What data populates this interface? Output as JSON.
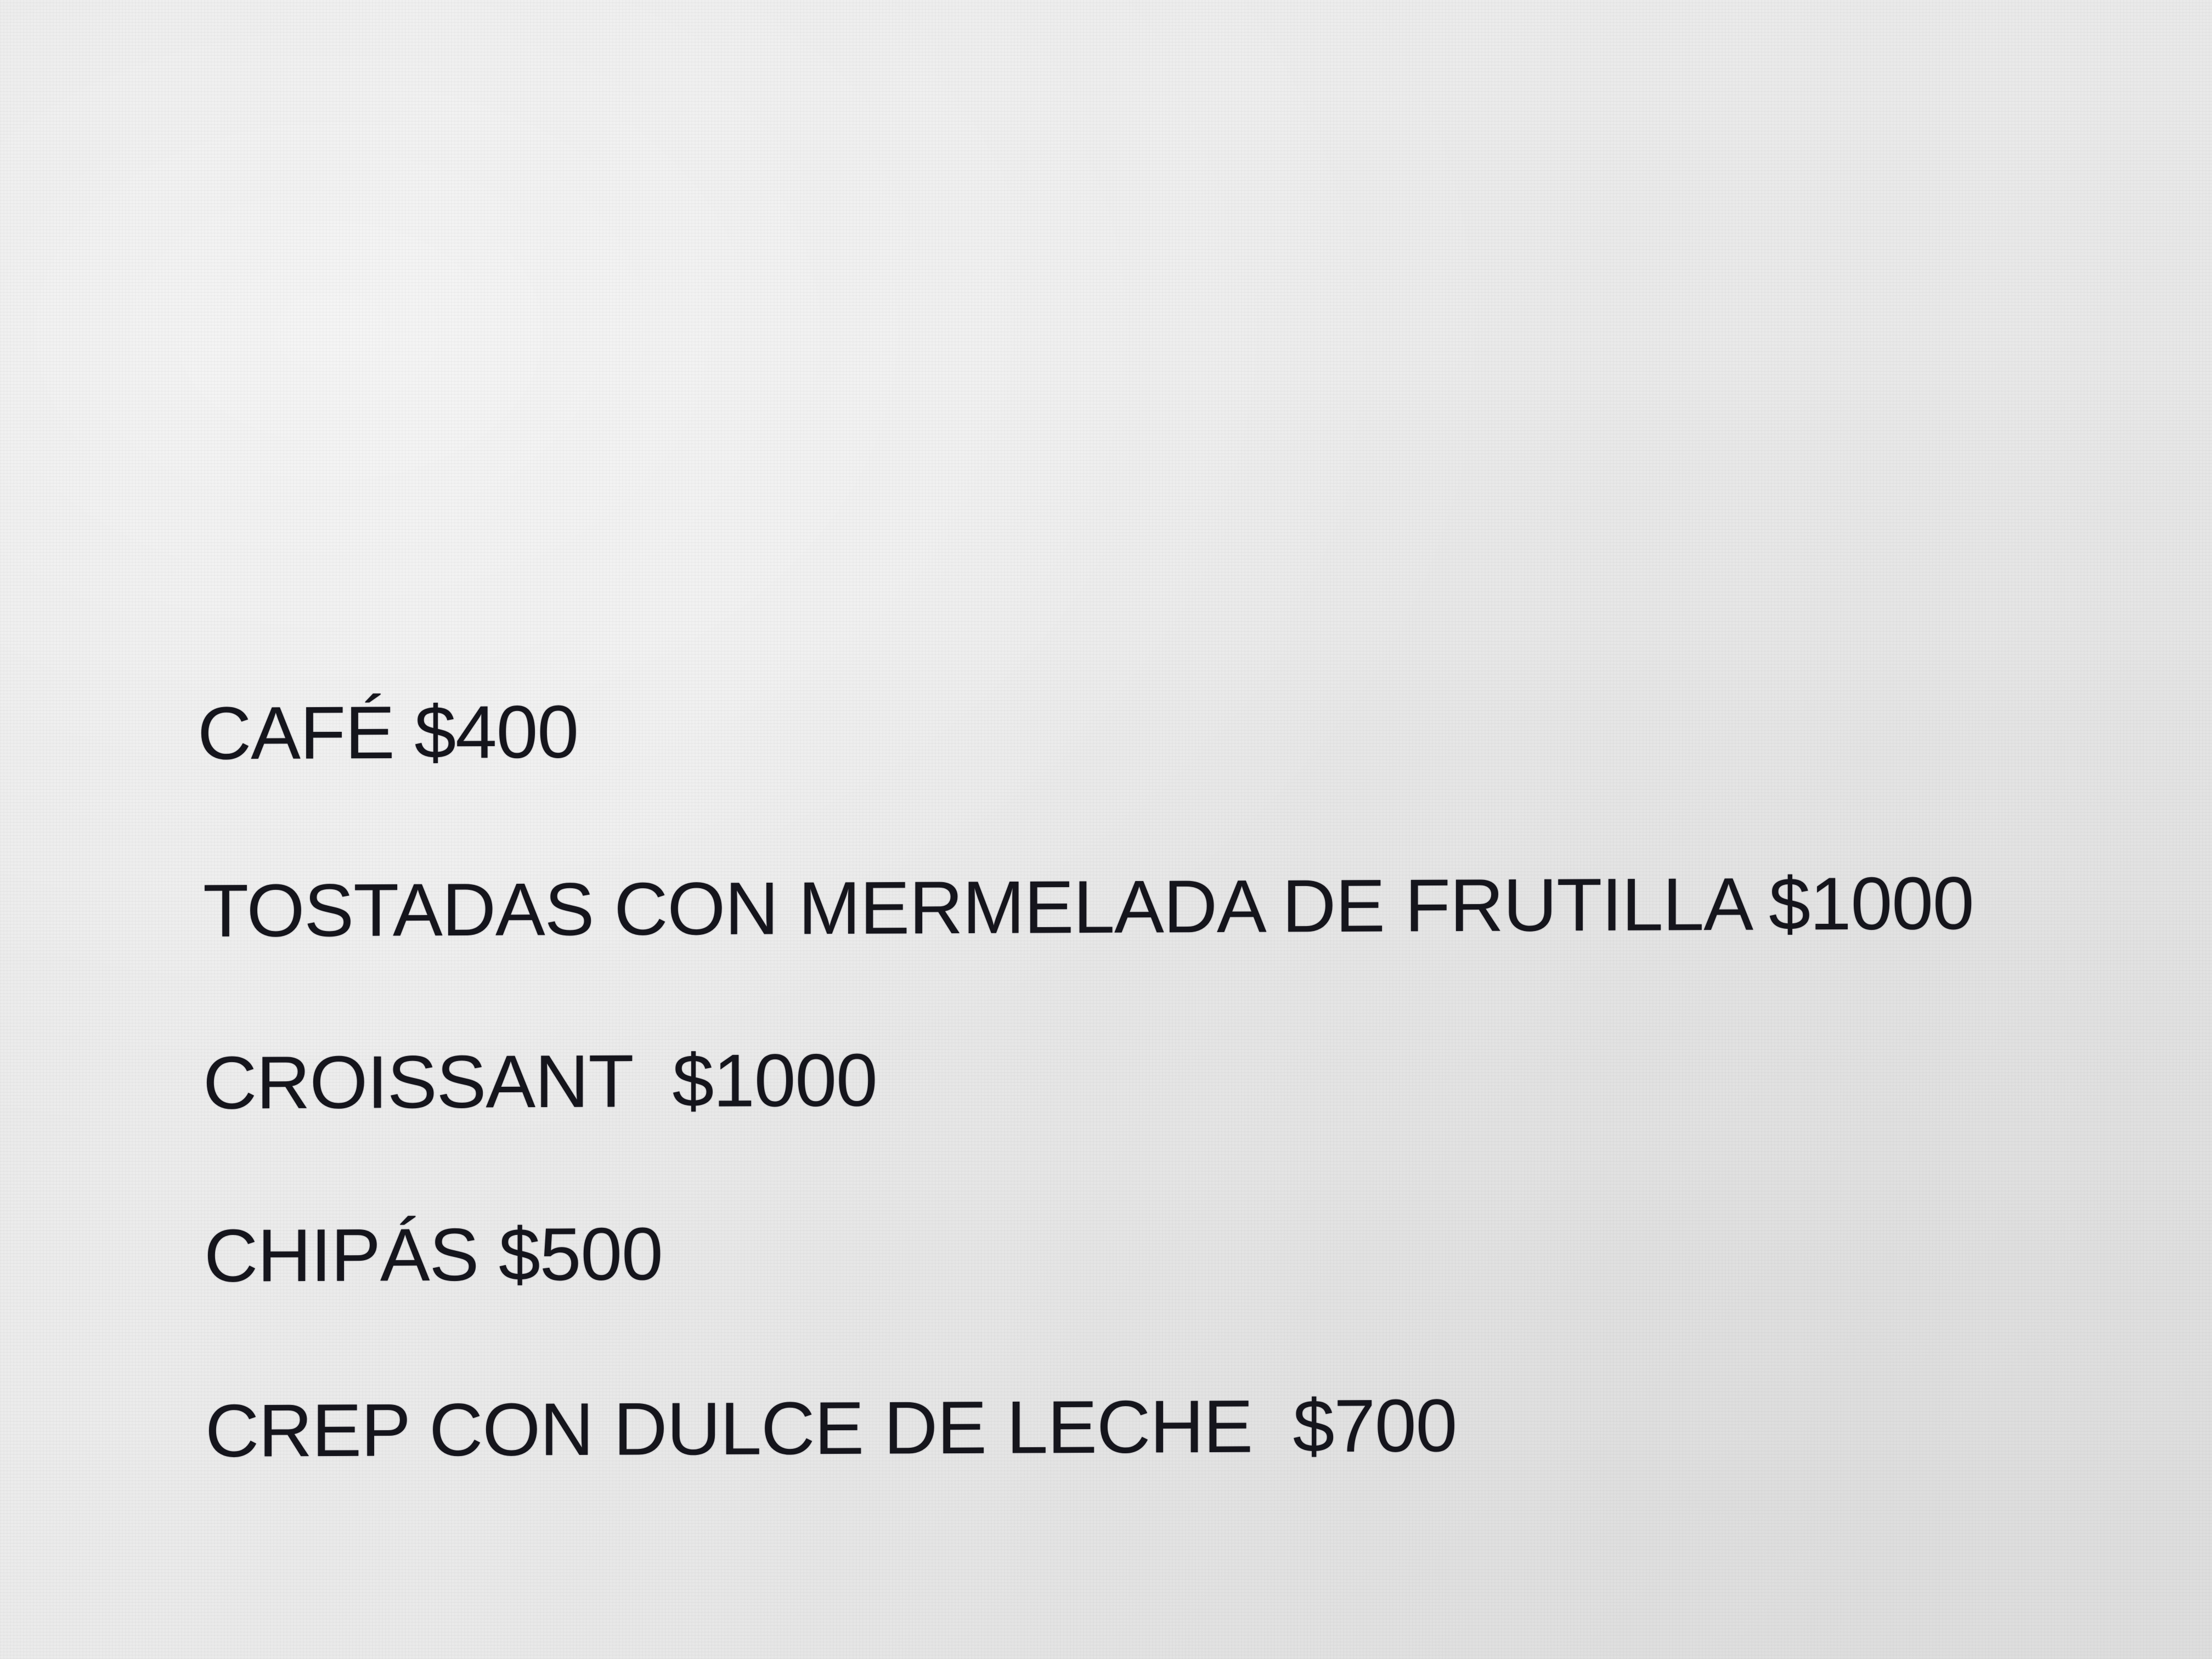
{
  "menu": {
    "items": [
      {
        "text": "CAFÉ $400"
      },
      {
        "text": "TOSTADAS CON MERMELADA DE FRUTILLA $1000"
      },
      {
        "text": "CROISSANT  $1000"
      },
      {
        "text": "CHIPÁS $500"
      },
      {
        "text": "CREP CON DULCE DE LECHE  $700"
      }
    ]
  },
  "colors": {
    "background": "#e8e8e8",
    "text": "#15151c"
  }
}
